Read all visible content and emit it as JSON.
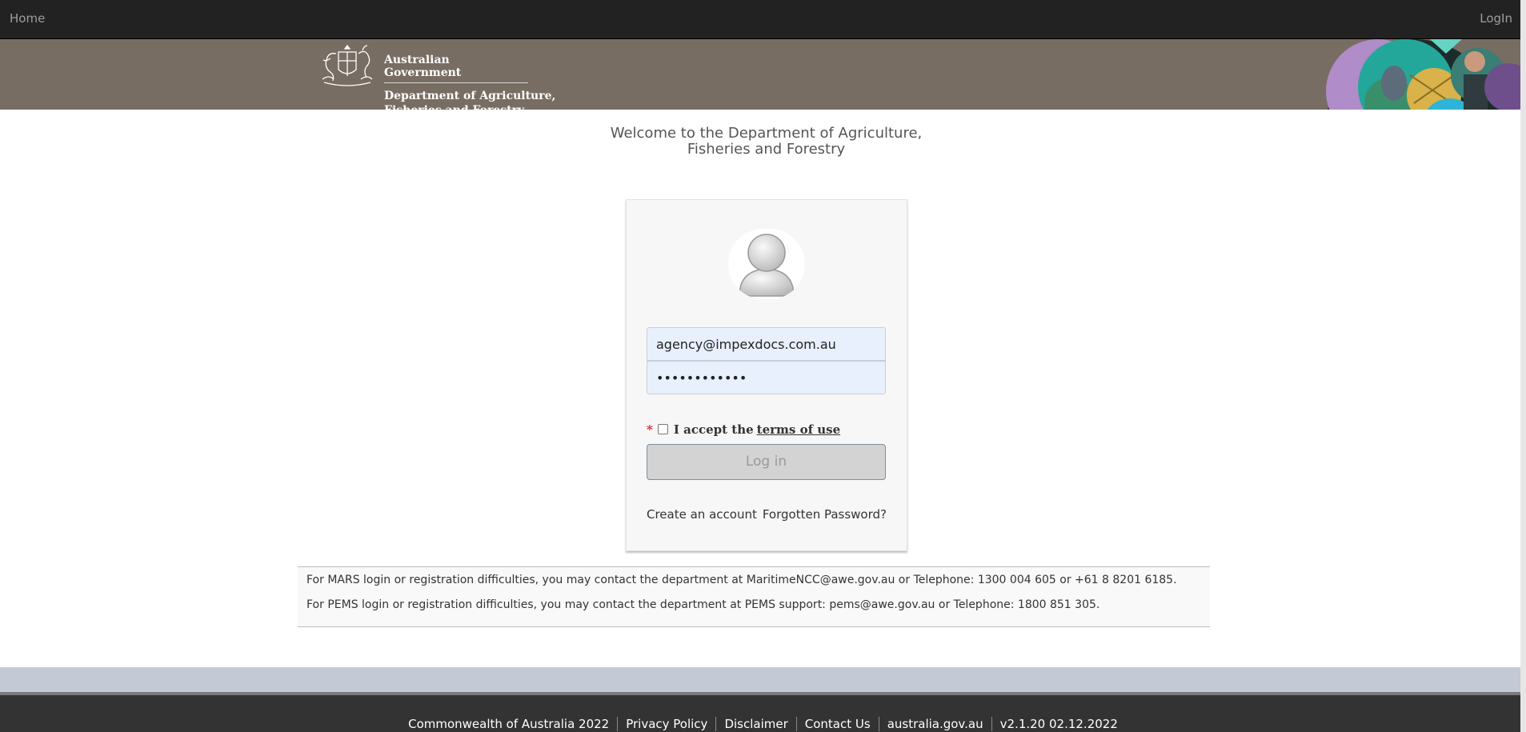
{
  "nav": {
    "home": "Home",
    "login": "LogIn"
  },
  "banner": {
    "gov_line1": "Australian Government",
    "dept_line1": "Department of Agriculture,",
    "dept_line2": "Fisheries and Forestry"
  },
  "welcome": {
    "line1": "Welcome to the Department of Agriculture,",
    "line2": "Fisheries and Forestry"
  },
  "login": {
    "email_value": "agency@impexdocs.com.au",
    "password_value": "••••••••••••",
    "required_marker": "*",
    "terms_prefix": "I accept the",
    "terms_link": "terms of use",
    "terms_checked": false,
    "button": "Log in",
    "create_account": "Create an account",
    "forgot_password": "Forgotten Password?"
  },
  "info": {
    "mars": "For MARS login or registration difficulties, you may contact the department at MaritimeNCC@awe.gov.au or Telephone: 1300 004 605 or +61 8 8201 6185.",
    "pems": "For PEMS login or registration difficulties, you may contact the department at PEMS support: pems@awe.gov.au or Telephone: 1800 851 305."
  },
  "footer": {
    "items": [
      "Commonwealth of Australia 2022",
      "Privacy Policy",
      "Disclaimer",
      "Contact Us",
      "australia.gov.au",
      "v2.1.20 02.12.2022"
    ]
  },
  "icons": {
    "crest": "coat-of-arms-icon",
    "avatar": "user-avatar-icon",
    "checkbox": "checkbox-icon"
  },
  "colors": {
    "topbar": "#222222",
    "banner": "#786d63",
    "footer": "#333333",
    "band": "#c3cad6",
    "required": "#d9262b"
  }
}
